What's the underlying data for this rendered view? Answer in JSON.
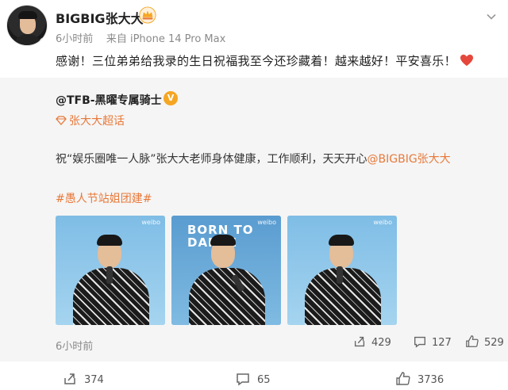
{
  "post": {
    "username": "BIGBIG张大大",
    "time": "6小时前",
    "source": "来自 iPhone 14 Pro Max",
    "text": "感谢！三位弟弟给我录的生日祝福我至今还珍藏着！越来越好！平安喜乐！"
  },
  "repost": {
    "username": "@TFB-黑曜专属骑士",
    "supertopic": "张大大超话",
    "text_prefix": "祝“娱乐圈唯一人脉”张大大老师身体健康，工作顺利，天天开心",
    "mention": "@BIGBIG张大大",
    "hashtag": "#愚人节站姐团建#",
    "photos": [
      {
        "watermark": "weibo",
        "stage_text": ""
      },
      {
        "watermark": "weibo",
        "stage_text": "BORN TO\nDANCE"
      },
      {
        "watermark": "weibo",
        "stage_text": ""
      }
    ],
    "time": "6小时前",
    "reposts": "429",
    "comments": "127",
    "likes": "529"
  },
  "actions": {
    "share": "374",
    "comment": "65",
    "like": "3736"
  },
  "colors": {
    "accent": "#e8793a",
    "verified": "#f5a623",
    "heart": "#e5473c",
    "background_repost": "#f5f5f5"
  },
  "icons": {
    "verified_badge": "verified-v-badge-icon",
    "crown": "crown-icon",
    "chevron": "chevron-down-icon",
    "supertopic": "diamond-icon",
    "share": "share-icon",
    "comment": "comment-icon",
    "like": "thumbs-up-icon",
    "heart": "red-heart-emoji-icon"
  }
}
